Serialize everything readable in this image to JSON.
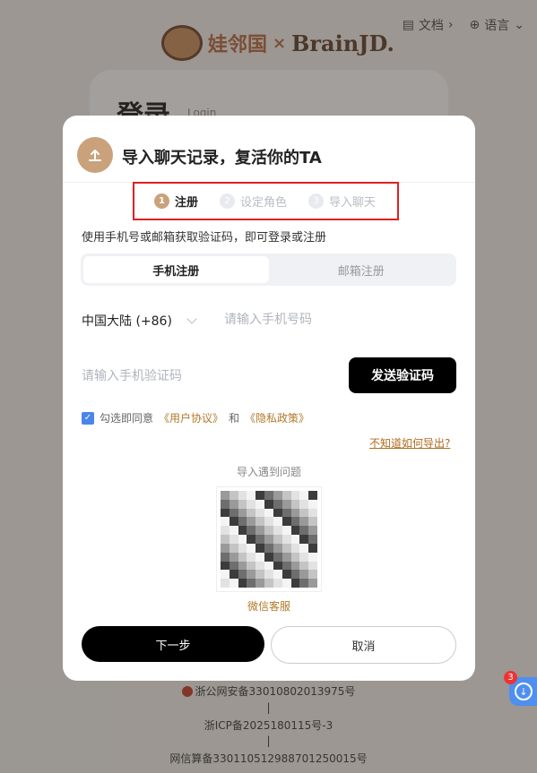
{
  "topbar": {
    "docs_label": "文档",
    "lang_label": "语言"
  },
  "logo": {
    "brand_a": "娃邻国",
    "separator": "×",
    "brand_b": "BrainJD."
  },
  "background_login": {
    "title": "登录",
    "subtitle": "Login"
  },
  "footer": {
    "police": "浙公网安备33010802013975号",
    "sep": "|",
    "icp": "浙ICP备2025180115号-3",
    "algo": "网信算备330110512988701250015号"
  },
  "floating": {
    "badge_count": "3"
  },
  "modal": {
    "title": "导入聊天记录，复活你的TA",
    "steps": [
      {
        "num": "1",
        "label": "注册"
      },
      {
        "num": "2",
        "label": "设定角色"
      },
      {
        "num": "3",
        "label": "导入聊天"
      }
    ],
    "instruction": "使用手机号或邮箱获取验证码，即可登录或注册",
    "tabs": [
      {
        "label": "手机注册",
        "active": true
      },
      {
        "label": "邮箱注册",
        "active": false
      }
    ],
    "region": "中国大陆 (+86)",
    "phone_placeholder": "请输入手机号码",
    "code_placeholder": "请输入手机验证码",
    "send_code": "发送验证码",
    "agree_prefix": "勾选即同意",
    "user_agreement": "《用户协议》",
    "and_text": "和",
    "privacy_policy": "《隐私政策》",
    "help_link": "不知道如何导出?",
    "problem_title": "导入遇到问题",
    "qr_label": "微信客服",
    "next_button": "下一步",
    "cancel_button": "取消"
  },
  "colors": {
    "accent_gold": "#c9a27b",
    "link_gold": "#b07a2a",
    "highlight_red": "#e02020",
    "checkbox_blue": "#4a86e8"
  }
}
